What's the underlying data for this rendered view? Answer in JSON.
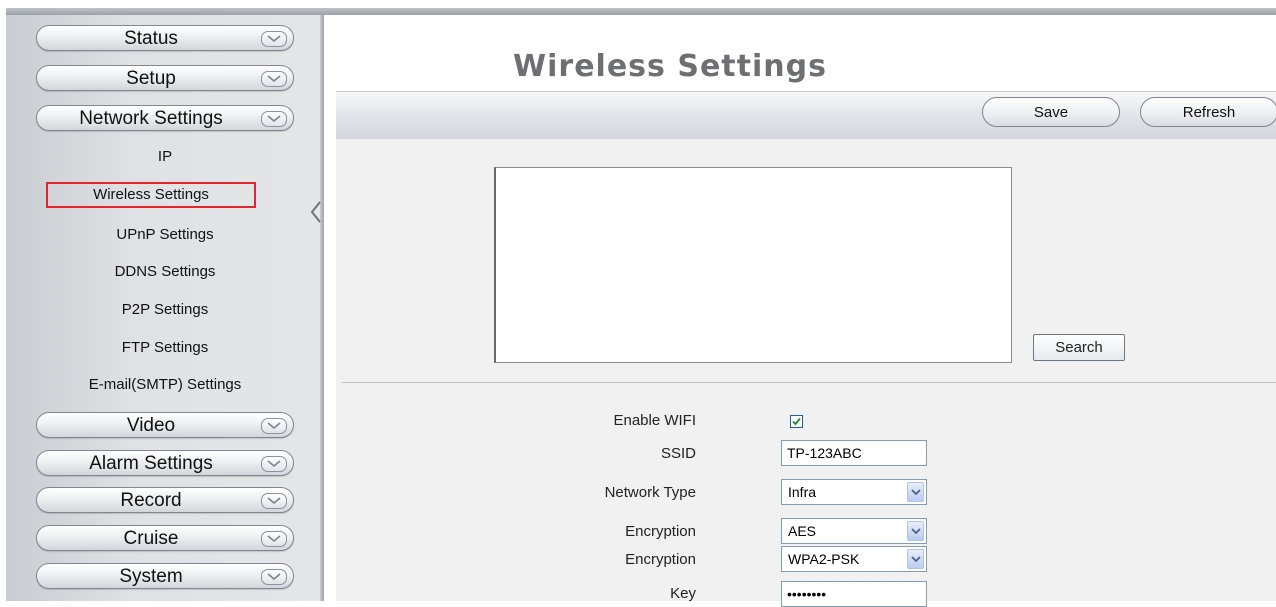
{
  "menu": {
    "top": [
      "Status",
      "Setup",
      "Network Settings"
    ],
    "network_sub": [
      "IP",
      "Wireless Settings",
      "UPnP Settings",
      "DDNS Settings",
      "P2P Settings",
      "FTP Settings",
      "E-mail(SMTP) Settings"
    ],
    "bottom": [
      "Video",
      "Alarm Settings",
      "Record",
      "Cruise",
      "System"
    ],
    "active_item": "Wireless Settings"
  },
  "page": {
    "title": "Wireless Settings",
    "save_label": "Save",
    "refresh_label": "Refresh",
    "search_label": "Search"
  },
  "form": {
    "enable_wifi": {
      "label": "Enable WIFI",
      "checked": true
    },
    "ssid": {
      "label": "SSID",
      "value": "TP-123ABC"
    },
    "network_type": {
      "label": "Network Type",
      "value": "Infra"
    },
    "encryption": {
      "label": "Encryption",
      "value": "AES"
    },
    "encryption2": {
      "label": "Encryption",
      "value": "WPA2-PSK"
    },
    "key": {
      "label": "Key",
      "value": "••••••••"
    }
  },
  "colors": {
    "active_outline": "#e3262b",
    "title_gray": "#6d6f73"
  }
}
